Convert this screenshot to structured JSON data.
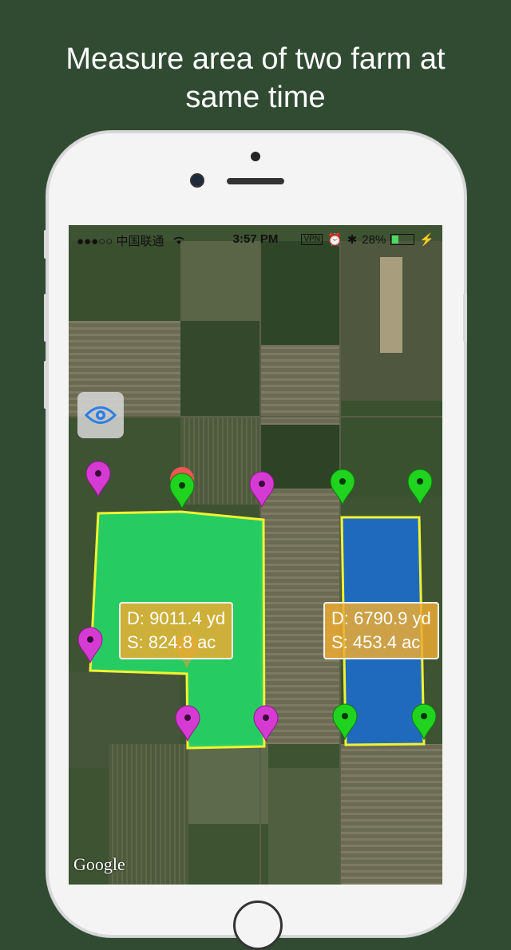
{
  "headline": {
    "line1": "Measure area of two farm at",
    "line2": "same time"
  },
  "statusbar": {
    "carrier": "●●●○○ 中国联通",
    "wifi_icon": "wifi-icon",
    "time": "3:57 PM",
    "vpn": "VPN",
    "battery_percent": "28%",
    "battery_level": 0.28
  },
  "map": {
    "provider_logo": "Google",
    "eye_button_icon": "eye-icon",
    "colors": {
      "field1_fill": "#22e26a",
      "field2_fill": "#1a6fd6",
      "outline": "#f2f233",
      "pin_magenta": "#d53bd3",
      "pin_green": "#1fd31f",
      "pin_red": "#ee5555"
    }
  },
  "measurements": [
    {
      "distance": "D: 9011.4 yd",
      "area": "S: 824.8 ac"
    },
    {
      "distance": "D: 6790.9 yd",
      "area": "S: 453.4 ac"
    }
  ]
}
